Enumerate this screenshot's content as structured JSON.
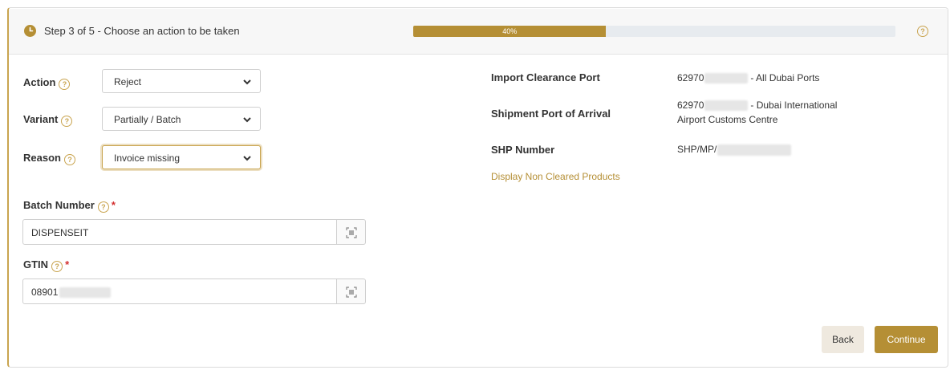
{
  "header": {
    "step_text": "Step 3 of 5 - Choose an action to be taken",
    "progress": {
      "value": 0.4,
      "label": "40%"
    }
  },
  "form": {
    "action": {
      "label": "Action",
      "value": "Reject"
    },
    "variant": {
      "label": "Variant",
      "value": "Partially / Batch"
    },
    "reason": {
      "label": "Reason",
      "value": "Invoice missing"
    },
    "batch_number": {
      "label": "Batch Number",
      "required": "*",
      "value": "DISPENSEIT"
    },
    "gtin": {
      "label": "GTIN",
      "required": "*",
      "value_prefix": "08901"
    }
  },
  "details": {
    "import_clearance_port": {
      "label": "Import Clearance Port",
      "value_prefix": "62970",
      "value_suffix": "- All Dubai Ports"
    },
    "shipment_port_of_arrival": {
      "label": "Shipment Port of Arrival",
      "value_prefix": "62970",
      "value_suffix": "- Dubai International",
      "value_line2": "Airport Customs Centre"
    },
    "shp_number": {
      "label": "SHP Number",
      "value_prefix": "SHP/MP/"
    },
    "link": "Display Non Cleared Products"
  },
  "buttons": {
    "back": "Back",
    "continue": "Continue"
  },
  "colors": {
    "accent": "#b58f35",
    "required": "#d32f2f"
  }
}
